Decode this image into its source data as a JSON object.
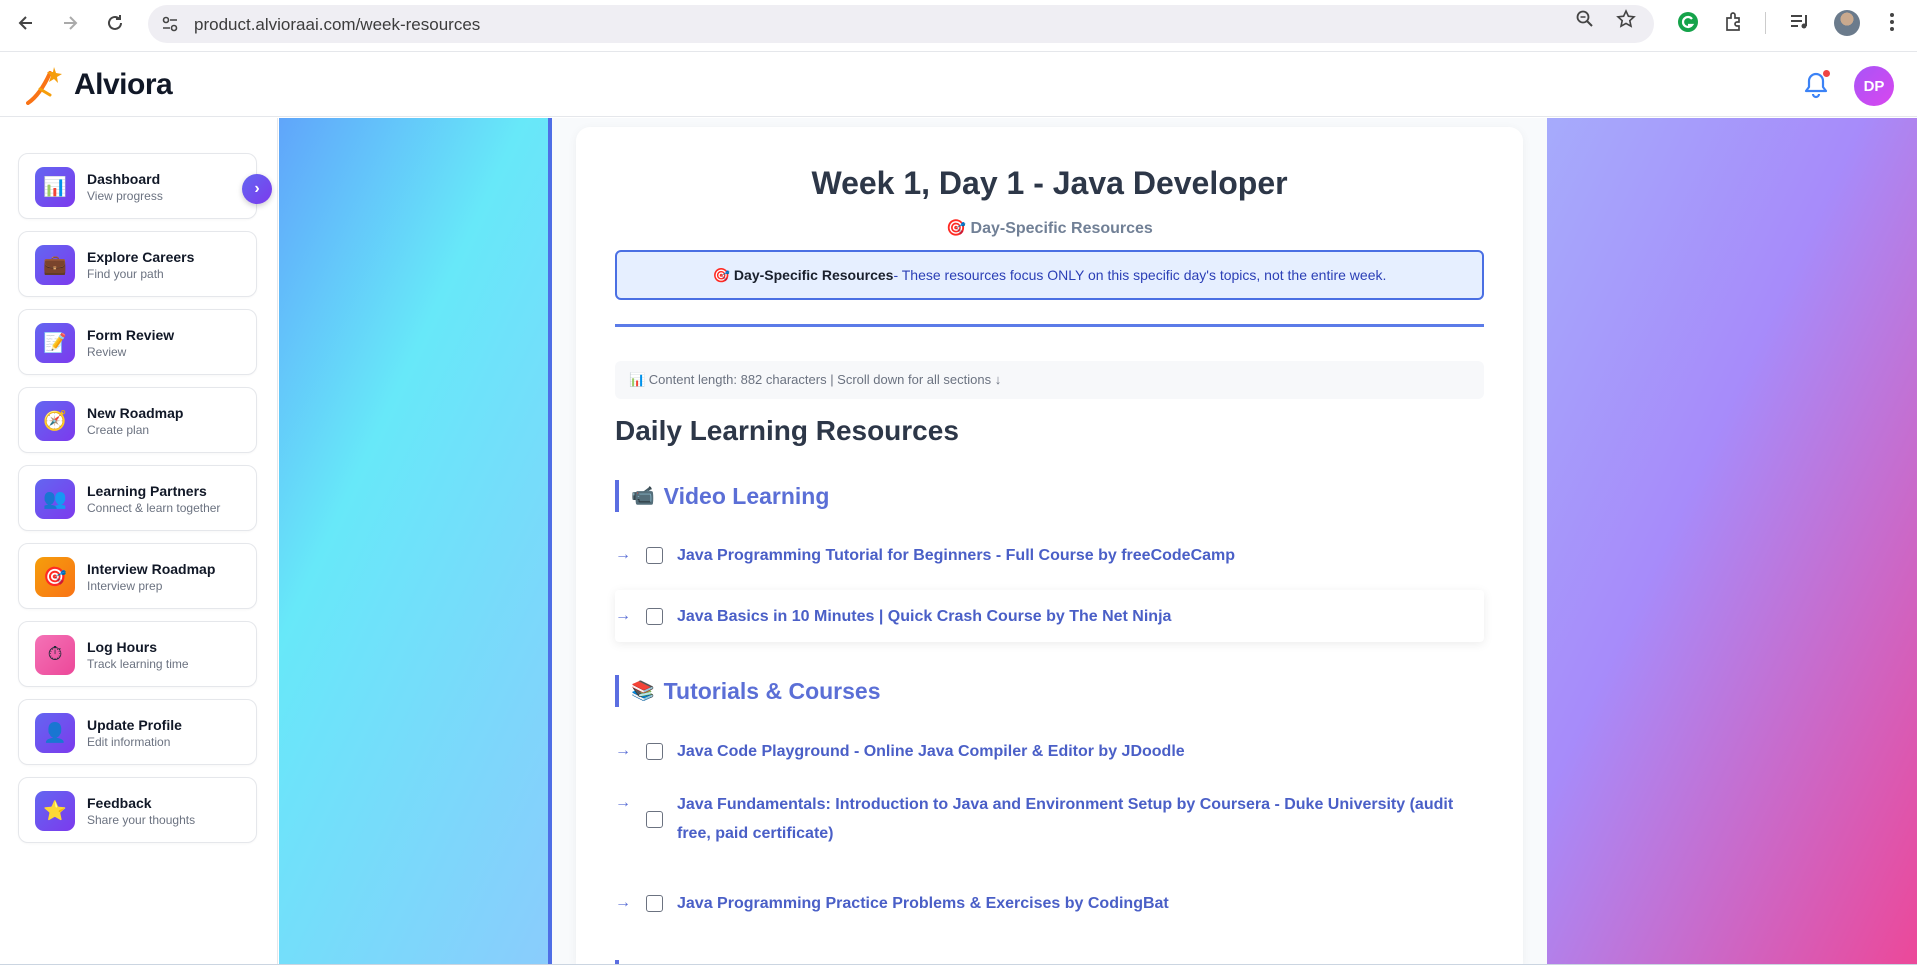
{
  "browser": {
    "url": "product.alvioraai.com/week-resources",
    "back_icon": "arrow-left",
    "forward_icon": "arrow-right",
    "reload_icon": "reload"
  },
  "header": {
    "brand": "Alviora",
    "avatar_initials": "DP"
  },
  "sidebar": {
    "items": [
      {
        "title": "Dashboard",
        "subtitle": "View progress",
        "icon": "📊"
      },
      {
        "title": "Explore Careers",
        "subtitle": "Find your path",
        "icon": "💼"
      },
      {
        "title": "Form Review",
        "subtitle": "Review",
        "icon": "📝"
      },
      {
        "title": "New Roadmap",
        "subtitle": "Create plan",
        "icon": "🧭"
      },
      {
        "title": "Learning Partners",
        "subtitle": "Connect & learn together",
        "icon": "👥"
      },
      {
        "title": "Interview Roadmap",
        "subtitle": "Interview prep",
        "icon": "🎯"
      },
      {
        "title": "Log Hours",
        "subtitle": "Track learning time",
        "icon": "⏱"
      },
      {
        "title": "Update Profile",
        "subtitle": "Edit information",
        "icon": "👤"
      },
      {
        "title": "Feedback",
        "subtitle": "Share your thoughts",
        "icon": "⭐"
      }
    ]
  },
  "main": {
    "title": "Week 1, Day 1 - Java Developer",
    "subtitle": "🎯 Day-Specific Resources",
    "notice_strong": "🎯 Day-Specific Resources",
    "notice_text": " - These resources focus ONLY on this specific day's topics, not the entire week.",
    "meta": "📊 Content length: 882 characters | Scroll down for all sections ↓",
    "section_heading": "Daily Learning Resources",
    "categories": [
      {
        "emoji": "📹",
        "title": "Video Learning",
        "resources": [
          "Java Programming Tutorial for Beginners - Full Course by freeCodeCamp",
          "Java Basics in 10 Minutes | Quick Crash Course by The Net Ninja"
        ]
      },
      {
        "emoji": "📚",
        "title": "Tutorials & Courses",
        "resources": [
          "Java Code Playground - Online Java Compiler & Editor by JDoodle",
          "Java Fundamentals: Introduction to Java and Environment Setup by Coursera - Duke University (audit free, paid certificate)",
          "Java Programming Practice Problems & Exercises by CodingBat"
        ]
      }
    ]
  },
  "colors": {
    "accent": "#5b6fd6",
    "notice_border": "#4a6fe3",
    "avatar_gradient": "#a855f7"
  }
}
